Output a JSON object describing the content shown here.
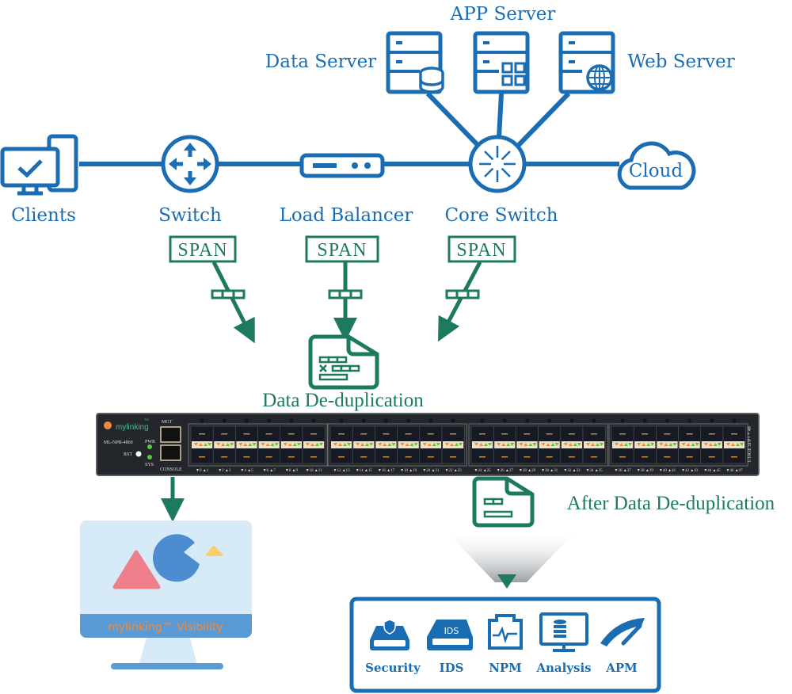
{
  "nodes": {
    "clients": "Clients",
    "switch": "Switch",
    "load_balancer": "Load Balancer",
    "core_switch": "Core Switch",
    "cloud": "Cloud",
    "data_server": "Data Server",
    "app_server": "APP Server",
    "web_server": "Web Server"
  },
  "span_label": "SPAN",
  "dedup_label": "Data De-duplication",
  "after_dedup_label": "After Data De-duplication",
  "device": {
    "brand": "mylinking",
    "trademark": "TM",
    "model": "ML-NPB-4860",
    "mgt": "MGT",
    "console": "CONSOLE",
    "pwr": "PWR",
    "sys": "SYS",
    "rst": "RST",
    "side_label": "1/10GE SFP+ * 48",
    "port_labels": [
      "▼0 ▲1",
      "▼2 ▲3",
      "▼4 ▲5",
      "▼6 ▲7",
      "▼8 ▲9",
      "▼10 ▲11",
      "▼12 ▲13",
      "▼14 ▲15",
      "▼16 ▲17",
      "▼18 ▲19",
      "▼20 ▲21",
      "▼22 ▲23",
      "▼24 ▲25",
      "▼26 ▲27",
      "▼28 ▲29",
      "▼30 ▲31",
      "▼32 ▲33",
      "▼34 ▲35",
      "▼36 ▲37",
      "▼38 ▲39",
      "▼40 ▲41",
      "▼42 ▲43",
      "▼44 ▲45",
      "▼46 ▲47"
    ]
  },
  "monitor": {
    "caption": "mylinking™ Visibility"
  },
  "tools": [
    "Security",
    "IDS",
    "NPM",
    "Analysis",
    "APM"
  ],
  "ids_badge": "IDS",
  "colors": {
    "blue": "#1a6db3",
    "green": "#1d7a5f",
    "device": "#23272b",
    "orange": "#f08a3c"
  }
}
